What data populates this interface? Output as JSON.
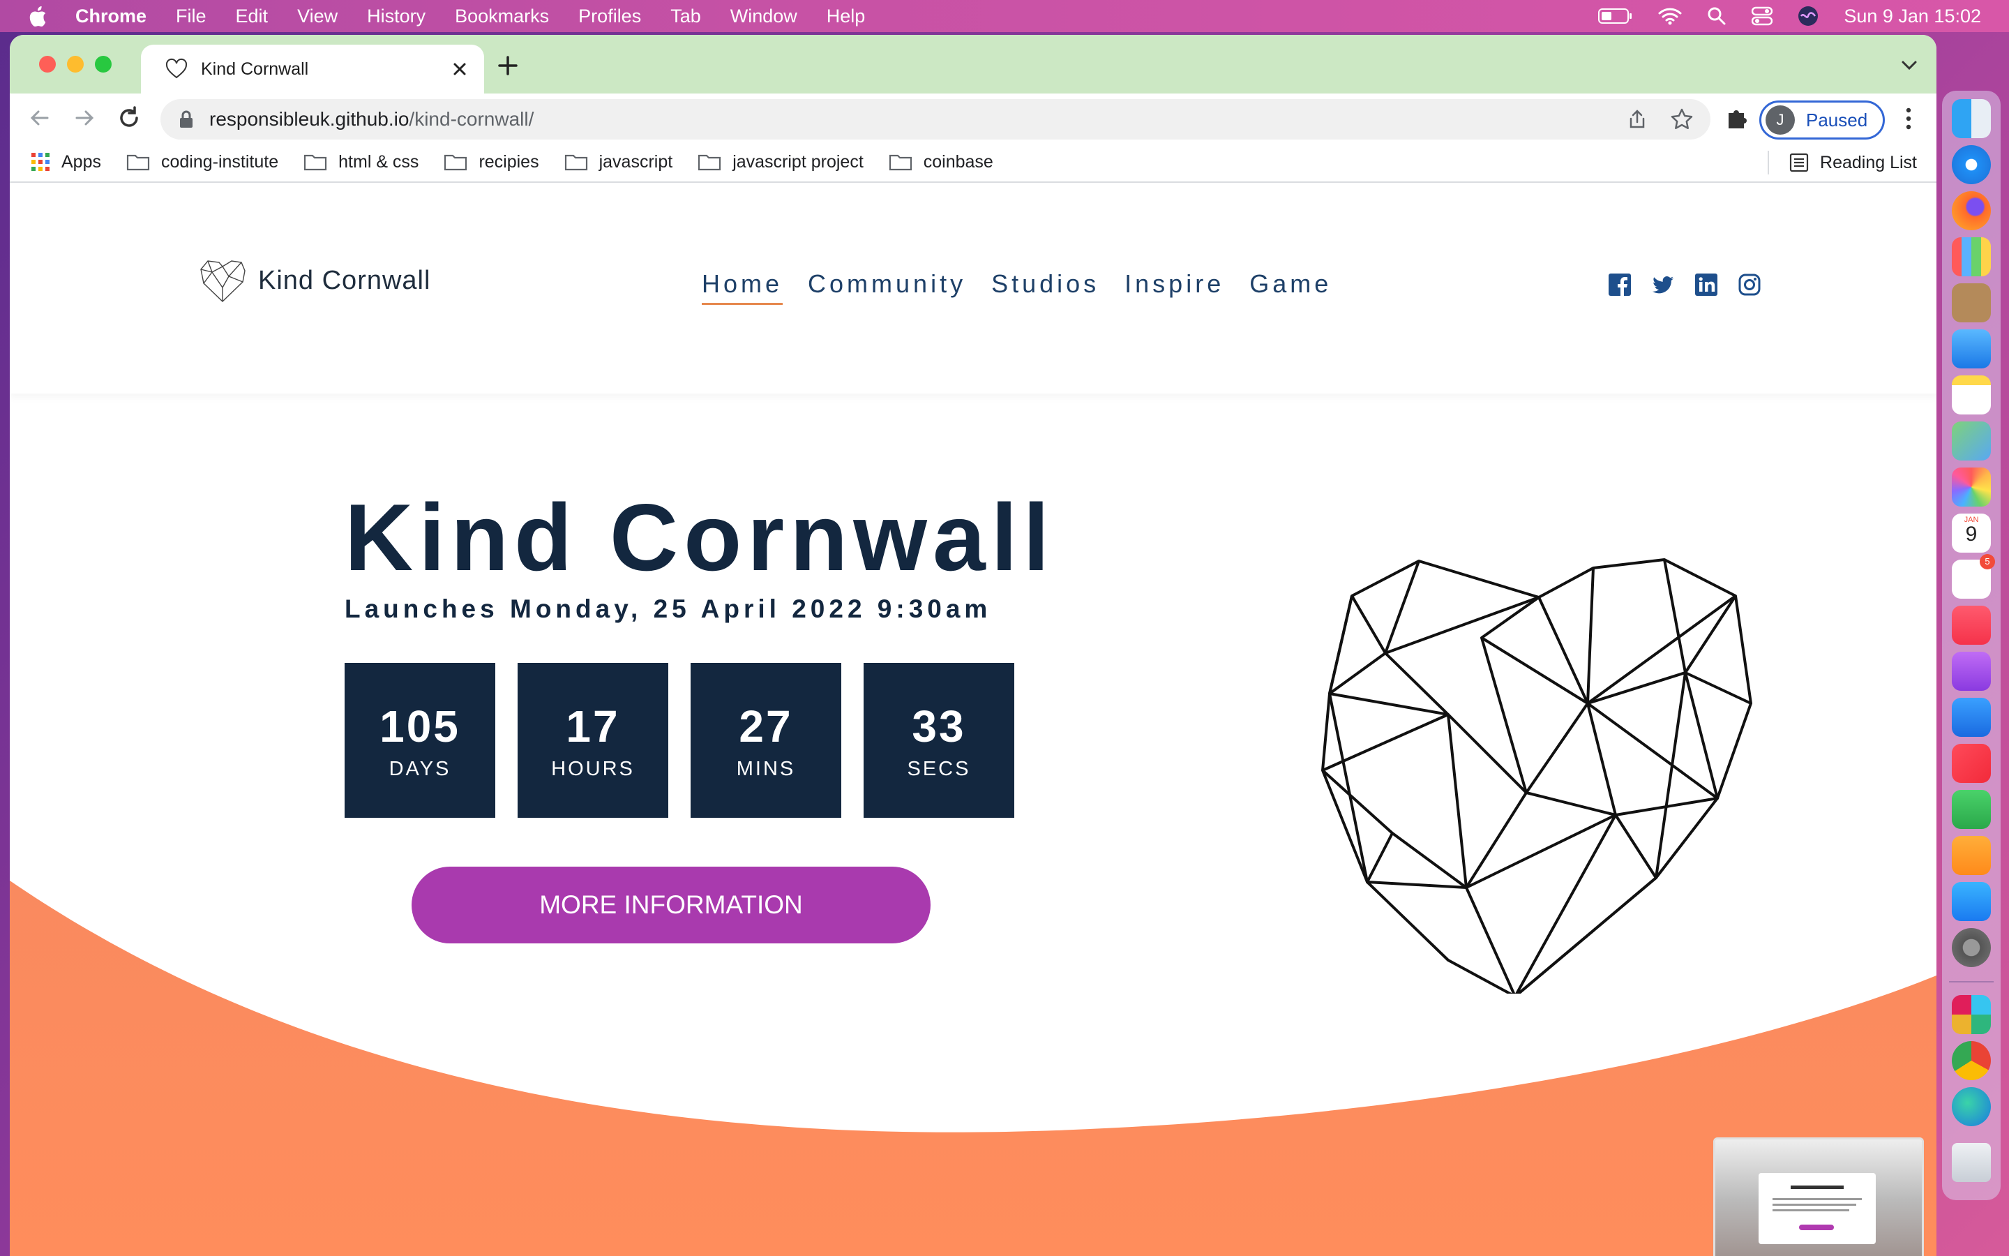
{
  "menubar": {
    "app_name": "Chrome",
    "items": [
      "File",
      "Edit",
      "View",
      "History",
      "Bookmarks",
      "Profiles",
      "Tab",
      "Window",
      "Help"
    ],
    "clock": "Sun 9 Jan  15:02"
  },
  "browser": {
    "tab_title": "Kind Cornwall",
    "url_host": "responsibleuk.github.io",
    "url_path": "/kind-cornwall/",
    "profile_initial": "J",
    "profile_status": "Paused",
    "bookmarks": [
      "Apps",
      "coding-institute",
      "html & css",
      "recipies",
      "javascript",
      "javascript project",
      "coinbase"
    ],
    "reading_list": "Reading List"
  },
  "site": {
    "logo_text": "Kind Cornwall",
    "nav": [
      "Home",
      "Community",
      "Studios",
      "Inspire",
      "Game"
    ],
    "hero_title": "Kind Cornwall",
    "hero_subtitle": "Launches Monday, 25 April 2022 9:30am",
    "countdown": [
      {
        "value": "105",
        "label": "DAYS"
      },
      {
        "value": "17",
        "label": "HOURS"
      },
      {
        "value": "27",
        "label": "MINS"
      },
      {
        "value": "33",
        "label": "SECS"
      }
    ],
    "cta_label": "MORE INFORMATION",
    "social": [
      "facebook-icon",
      "twitter-icon",
      "linkedin-icon",
      "instagram-icon"
    ],
    "brand_colors": {
      "navy": "#13273f",
      "purple": "#a93aae",
      "orange": "#f9885e",
      "nav_text": "#1e4068"
    }
  },
  "dock": {
    "apps": [
      "finder",
      "safari",
      "firefox",
      "launchpad",
      "contacts",
      "mail",
      "notes",
      "maps",
      "photos",
      "calendar",
      "reminders",
      "music",
      "podcasts",
      "keynote",
      "news",
      "numbers",
      "pages",
      "app-store",
      "system-preferences",
      "slack",
      "chrome",
      "edge",
      "trash"
    ],
    "calendar_month": "JAN",
    "calendar_day": "9",
    "reminders_badge": "5"
  }
}
